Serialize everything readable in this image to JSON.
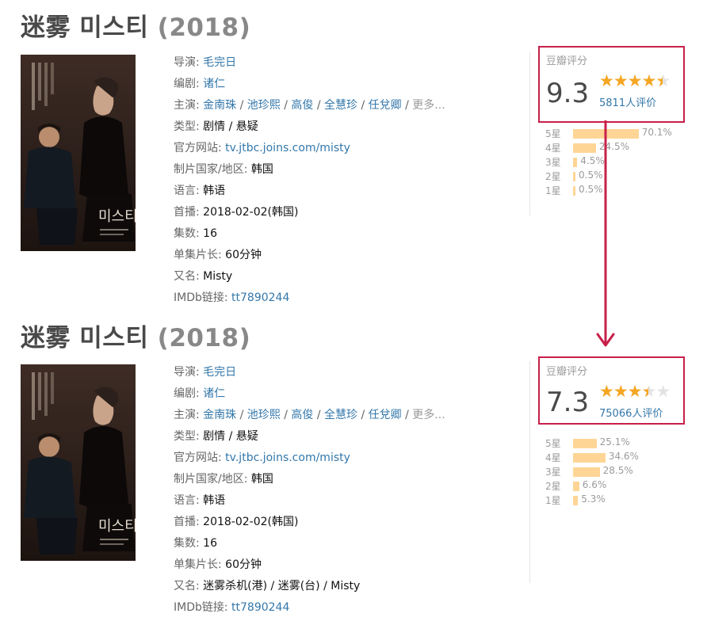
{
  "colors": {
    "accent_frame": "#c8204a",
    "link": "#3377aa",
    "star": "#f5a623",
    "bar": "#ffd596"
  },
  "top": {
    "title_main": "迷雾 미스티",
    "title_year": "(2018)",
    "poster_name": "미스티",
    "info": {
      "director_label": "导演:",
      "director": "毛完日",
      "writer_label": "编剧:",
      "writer": "诸仁",
      "cast_label": "主演:",
      "cast": [
        "金南珠",
        "池珍熙",
        "高俊",
        "全慧珍",
        "任兌卿"
      ],
      "cast_sep": " / ",
      "cast_more": "更多...",
      "genre_label": "类型:",
      "genre": "剧情 / 悬疑",
      "website_label": "官方网站:",
      "website": "tv.jtbc.joins.com/misty",
      "country_label": "制片国家/地区:",
      "country": "韩国",
      "language_label": "语言:",
      "language": "韩语",
      "premiere_label": "首播:",
      "premiere": "2018-02-02(韩国)",
      "episodes_label": "集数:",
      "episodes": "16",
      "runtime_label": "单集片长:",
      "runtime": "60分钟",
      "aka_label": "又名:",
      "aka": "Misty",
      "imdb_label": "IMDb链接:",
      "imdb": "tt7890244"
    },
    "rating": {
      "label": "豆瓣评分",
      "score": "9.3",
      "stars": 4.5,
      "count": "5811人评价",
      "dist": [
        {
          "label": "5星",
          "pct": "70.1%",
          "value": 70.1
        },
        {
          "label": "4星",
          "pct": "24.5%",
          "value": 24.5
        },
        {
          "label": "3星",
          "pct": "4.5%",
          "value": 4.5
        },
        {
          "label": "2星",
          "pct": "0.5%",
          "value": 0.5
        },
        {
          "label": "1星",
          "pct": "0.5%",
          "value": 0.5
        }
      ]
    }
  },
  "bottom": {
    "title_main": "迷雾 미스티",
    "title_year": "(2018)",
    "poster_name": "미스티",
    "info": {
      "director_label": "导演:",
      "director": "毛完日",
      "writer_label": "编剧:",
      "writer": "诸仁",
      "cast_label": "主演:",
      "cast": [
        "金南珠",
        "池珍熙",
        "高俊",
        "全慧珍",
        "任兌卿"
      ],
      "cast_sep": " / ",
      "cast_more": "更多...",
      "genre_label": "类型:",
      "genre": "剧情 / 悬疑",
      "website_label": "官方网站:",
      "website": "tv.jtbc.joins.com/misty",
      "country_label": "制片国家/地区:",
      "country": "韩国",
      "language_label": "语言:",
      "language": "韩语",
      "premiere_label": "首播:",
      "premiere": "2018-02-02(韩国)",
      "episodes_label": "集数:",
      "episodes": "16",
      "runtime_label": "单集片长:",
      "runtime": "60分钟",
      "aka_label": "又名:",
      "aka": "迷雾杀机(港) / 迷雾(台) / Misty",
      "imdb_label": "IMDb链接:",
      "imdb": "tt7890244"
    },
    "rating": {
      "label": "豆瓣评分",
      "score": "7.3",
      "stars": 3.5,
      "count": "75066人评价",
      "dist": [
        {
          "label": "5星",
          "pct": "25.1%",
          "value": 25.1
        },
        {
          "label": "4星",
          "pct": "34.6%",
          "value": 34.6
        },
        {
          "label": "3星",
          "pct": "28.5%",
          "value": 28.5
        },
        {
          "label": "2星",
          "pct": "6.6%",
          "value": 6.6
        },
        {
          "label": "1星",
          "pct": "5.3%",
          "value": 5.3
        }
      ]
    }
  }
}
